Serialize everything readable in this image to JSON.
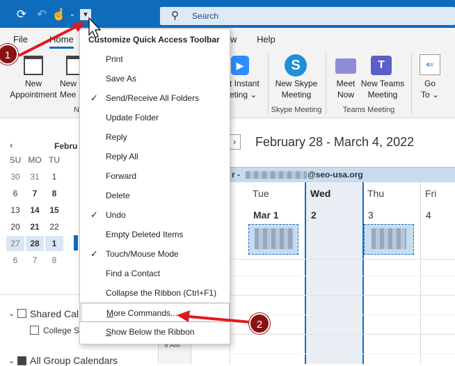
{
  "search": {
    "placeholder": "Search"
  },
  "ribbon": {
    "tabs": [
      "File",
      "Home",
      "w",
      "Help"
    ],
    "buttons": {
      "new_appointment": [
        "New",
        "Appointment"
      ],
      "new_meeting": [
        "New",
        "Mee"
      ],
      "teams_instant": [
        "t Instant",
        "eting"
      ],
      "skype": [
        "New Skype",
        "Meeting"
      ],
      "meet_now": [
        "Meet",
        "Now"
      ],
      "new_teams": [
        "New Teams",
        "Meeting"
      ],
      "go_to": [
        "Go",
        "To"
      ]
    },
    "groups": {
      "skype": "Skype Meeting",
      "teams": "Teams Meeting",
      "n": "N"
    }
  },
  "menu": {
    "title": "Customize Quick Access Toolbar",
    "items": [
      {
        "label": "Print",
        "checked": false
      },
      {
        "label": "Save As",
        "checked": false
      },
      {
        "label": "Send/Receive All Folders",
        "checked": true
      },
      {
        "label": "Update Folder",
        "checked": false
      },
      {
        "label": "Reply",
        "checked": false
      },
      {
        "label": "Reply All",
        "checked": false
      },
      {
        "label": "Forward",
        "checked": false
      },
      {
        "label": "Delete",
        "checked": false
      },
      {
        "label": "Undo",
        "checked": true
      },
      {
        "label": "Empty Deleted Items",
        "checked": false
      },
      {
        "label": "Touch/Mouse Mode",
        "checked": true
      },
      {
        "label": "Find a Contact",
        "checked": false
      },
      {
        "label": "Collapse the Ribbon (Ctrl+F1)",
        "checked": false
      },
      {
        "label": "More Commands...",
        "checked": false
      },
      {
        "label": "Show Below the Ribbon",
        "checked": false
      }
    ]
  },
  "mini_calendar": {
    "month": "Febru",
    "headers": [
      "SU",
      "MO",
      "TU"
    ],
    "rows": [
      [
        "30",
        "31",
        "1"
      ],
      [
        "6",
        "7",
        "8"
      ],
      [
        "13",
        "14",
        "15"
      ],
      [
        "20",
        "21",
        "22"
      ],
      [
        "27",
        "28",
        "1"
      ],
      [
        "6",
        "7",
        "8"
      ]
    ]
  },
  "folders": {
    "shared": "Shared Cal",
    "college": "College Se",
    "group": "All Group Calendars"
  },
  "calendar": {
    "range_title": "February 28 - March 4, 2022",
    "owner_prefix": "r -",
    "owner_suffix": "@seo-usa.org",
    "days": [
      {
        "name": "Tue",
        "num": "Mar 1"
      },
      {
        "name": "Wed",
        "num": "2"
      },
      {
        "name": "Thu",
        "num": "3"
      },
      {
        "name": "Fri",
        "num": "4"
      }
    ],
    "time_label": "9 AM"
  },
  "annotations": {
    "step1": "1",
    "step2": "2"
  },
  "colors": {
    "accent": "#0f6cbd",
    "badge": "#8b1212",
    "arrow": "#e0191f"
  }
}
